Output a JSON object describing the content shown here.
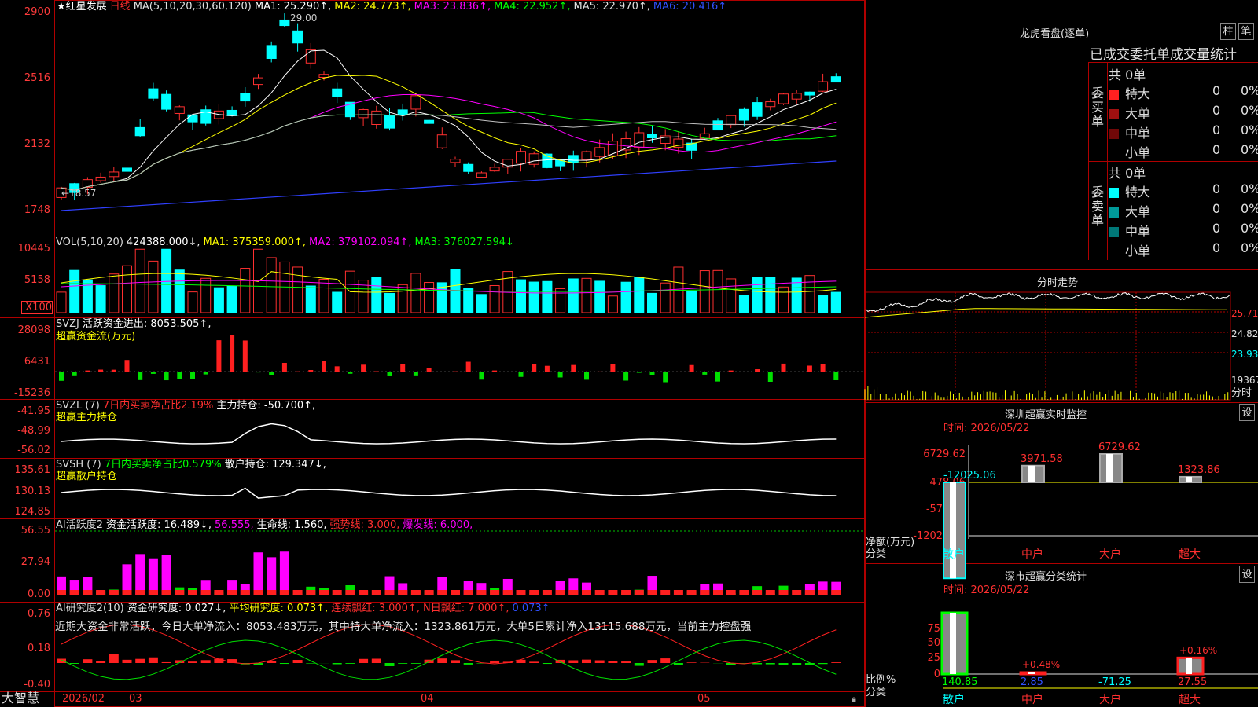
{
  "main_chart": {
    "star": "★",
    "stock_name": "红星发展",
    "period": "日线",
    "ma_label": "MA(5,10,20,30,60,120)",
    "ma1": "MA1: 25.290↑,",
    "ma2": "MA2: 24.773↑,",
    "ma3": "MA3: 23.836↑,",
    "ma4": "MA4: 22.952↑,",
    "ma5": "MA5: 22.970↑,",
    "ma6": "MA6: 20.416↑",
    "y_ticks": [
      "2900",
      "2516",
      "2132",
      "1748"
    ],
    "high_label": "29.00",
    "low_label": "←18.57",
    "colors": {
      "ma1": "#ffffff",
      "ma2": "#ffff00",
      "ma3": "#ff00ff",
      "ma4": "#00ff00",
      "ma5": "#c0c0c0",
      "ma6": "#3040ff",
      "up": "#ff3030",
      "down": "#00ffff"
    }
  },
  "volume_panel": {
    "label": "VOL(5,10,20)",
    "value": "424388.000↓,",
    "ma1": "MA1: 375359.000↑,",
    "ma2": "MA2: 379102.094↑,",
    "ma3": "MA3: 376027.594↓",
    "y_ticks": [
      "10445",
      "5158"
    ],
    "unit": "X100"
  },
  "svzj_panel": {
    "label": "SVZJ",
    "value": "活跃资金进出: 8053.505↑,",
    "subtitle": "超赢资金流(万元)",
    "y_ticks": [
      "28098",
      "6431",
      "-15236"
    ]
  },
  "svzl_panel": {
    "label": "SVZL (7)",
    "ratio": "7日内买卖净占比2.19%",
    "value": "主力持仓: -50.700↑,",
    "subtitle": "超赢主力持仓",
    "y_ticks": [
      "-41.95",
      "-48.99",
      "-56.02"
    ]
  },
  "svsh_panel": {
    "label": "SVSH (7)",
    "ratio": "7日内买卖净占比0.579%",
    "value": "散户持仓: 129.347↓,",
    "subtitle": "超赢散户持仓",
    "y_ticks": [
      "135.61",
      "130.13",
      "124.85"
    ]
  },
  "ai_active_panel": {
    "label": "AI活跃度2",
    "v1": "资金活跃度: 16.489↓,",
    "v2": "56.555,",
    "v3": "生命线: 1.560,",
    "v4": "强势线: 3.000,",
    "v5": "爆发线: 6.000,",
    "y_ticks": [
      "56.55",
      "27.94",
      "0.00"
    ]
  },
  "ai_research_panel": {
    "label": "AI研究度2(10)",
    "v1": "资金研究度: 0.027↓,",
    "v2": "平均研究度: 0.073↑,",
    "v3": "连续飘红: 3.000↑,",
    "v4": "N日飘红: 7.000↑,",
    "v5": "0.073↑",
    "message": "近期大资金非常活跃，今日大单净流入：8053.483万元，其中特大单净流入：1323.861万元，大单5日累计净入13115.688万元，当前主力控盘强",
    "y_ticks": [
      "0.76",
      "0.18",
      "-0.40"
    ]
  },
  "x_axis": {
    "brand": "大智慧",
    "labels": [
      "2026/02",
      "03",
      "04",
      "05"
    ]
  },
  "dragon_tiger": {
    "title": "龙虎看盘(逐单)",
    "btn_col": "柱",
    "btn_pen": "笔",
    "stats_title": "已成交委托单成交量统计",
    "buy_label": "委买单",
    "sell_label": "委卖单",
    "buy_total": "共 0单",
    "sell_total": "共 0单",
    "buy_rows": [
      {
        "name": "特大",
        "count": "0",
        "pct": "0%",
        "color": "#ff2020"
      },
      {
        "name": "大单",
        "count": "0",
        "pct": "0%",
        "color": "#a01010"
      },
      {
        "name": "中单",
        "count": "0",
        "pct": "0%",
        "color": "#700808"
      },
      {
        "name": "小单",
        "count": "0",
        "pct": "0%",
        "color": "#000000"
      }
    ],
    "sell_rows": [
      {
        "name": "特大",
        "count": "0",
        "pct": "0%",
        "color": "#00ffff"
      },
      {
        "name": "大单",
        "count": "0",
        "pct": "0%",
        "color": "#009a9a"
      },
      {
        "name": "中单",
        "count": "0",
        "pct": "0%",
        "color": "#007878"
      },
      {
        "name": "小单",
        "count": "0",
        "pct": "0%",
        "color": "#000000"
      }
    ]
  },
  "intraday": {
    "title": "分时走势",
    "price_ticks": [
      "25.71",
      "24.82",
      "23.93"
    ],
    "volume_tick": "19367",
    "vol_label": "分时"
  },
  "sz_monitor": {
    "title": "深圳超赢实时监控",
    "btn": "设",
    "time": "时间: 2026/05/22",
    "y_ticks": [
      "6729.62",
      "478.06",
      "-5773.5",
      "-12025.06"
    ],
    "bar_values": [
      "-12025.06",
      "3971.58",
      "6729.62",
      "1323.86"
    ],
    "categories": [
      "散户",
      "中户",
      "大户",
      "超大"
    ],
    "axis_caption_1": "净额(万元)",
    "axis_caption_2": "分类"
  },
  "sz_stats": {
    "title": "深市超赢分类统计",
    "btn": "设",
    "time": "时间: 2026/05/22",
    "y_ticks": [
      "75",
      "50",
      "25",
      "0"
    ],
    "bar_labels": [
      "+0.48%",
      "+0.16%"
    ],
    "values": [
      "140.85",
      "2.85",
      "-71.25",
      "27.55"
    ],
    "categories": [
      "散户",
      "中户",
      "大户",
      "超大"
    ],
    "axis_caption_1": "比例%",
    "axis_caption_2": "分类"
  }
}
